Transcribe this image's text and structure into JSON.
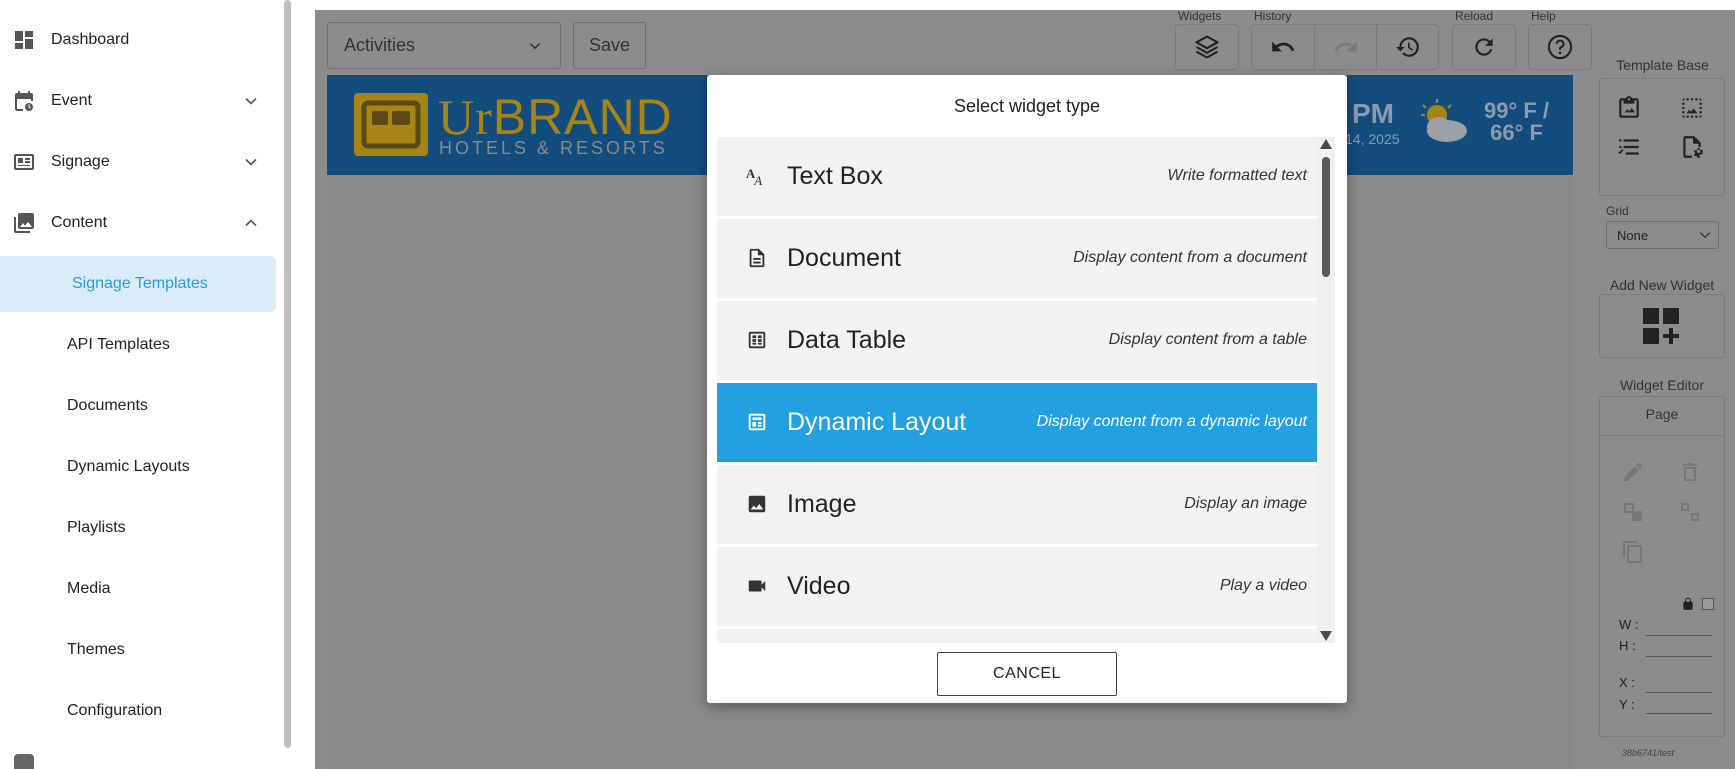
{
  "sidebar": {
    "items": [
      {
        "label": "Dashboard",
        "icon": "dashboard-icon"
      },
      {
        "label": "Event",
        "icon": "calendar-icon",
        "chevron": "down"
      },
      {
        "label": "Signage",
        "icon": "signage-icon",
        "chevron": "down"
      },
      {
        "label": "Content",
        "icon": "content-icon",
        "chevron": "up"
      }
    ],
    "sub_items": [
      {
        "label": "Signage Templates",
        "active": true
      },
      {
        "label": "API Templates"
      },
      {
        "label": "Documents"
      },
      {
        "label": "Dynamic Layouts"
      },
      {
        "label": "Playlists"
      },
      {
        "label": "Media"
      },
      {
        "label": "Themes"
      },
      {
        "label": "Configuration"
      }
    ]
  },
  "toolbar": {
    "page_select": "Activities",
    "save_label": "Save",
    "groups": {
      "widgets": "Widgets",
      "history": "History",
      "reload": "Reload",
      "help": "Help"
    }
  },
  "banner": {
    "logo_ur": "Ur",
    "logo_brand": "BRAND",
    "logo_sub": "HOTELS & RESORTS",
    "time": "PM",
    "date": "14, 2025",
    "temp_high": "99° F /",
    "temp_low": "66° F"
  },
  "right_panel": {
    "template_base": "Template Base",
    "grid_label": "Grid",
    "grid_value": "None",
    "add_new_widget": "Add New Widget",
    "widget_editor": "Widget Editor",
    "editor_target": "Page",
    "w_label": "W :",
    "h_label": "H :",
    "x_label": "X :",
    "y_label": "Y :",
    "footer_id": "38b6741/test"
  },
  "modal": {
    "title": "Select widget type",
    "cancel_label": "CANCEL",
    "widgets": [
      {
        "name": "Text Box",
        "description": "Write formatted text",
        "icon": "text-format-icon"
      },
      {
        "name": "Document",
        "description": "Display content from a document",
        "icon": "document-icon"
      },
      {
        "name": "Data Table",
        "description": "Display content from a table",
        "icon": "table-icon"
      },
      {
        "name": "Dynamic Layout",
        "description": "Display content from a dynamic layout",
        "icon": "dynamic-layout-icon",
        "selected": true
      },
      {
        "name": "Image",
        "description": "Display an image",
        "icon": "image-icon"
      },
      {
        "name": "Video",
        "description": "Play a video",
        "icon": "video-icon"
      }
    ]
  },
  "colors": {
    "accent": "#23a0e0",
    "sidebar_active_bg": "#d9ecf8",
    "sidebar_active_text": "#2a9bd8",
    "overlay": "#8c8c8c",
    "banner_bg": "#134d7d",
    "logo_gold": "#a88315"
  }
}
